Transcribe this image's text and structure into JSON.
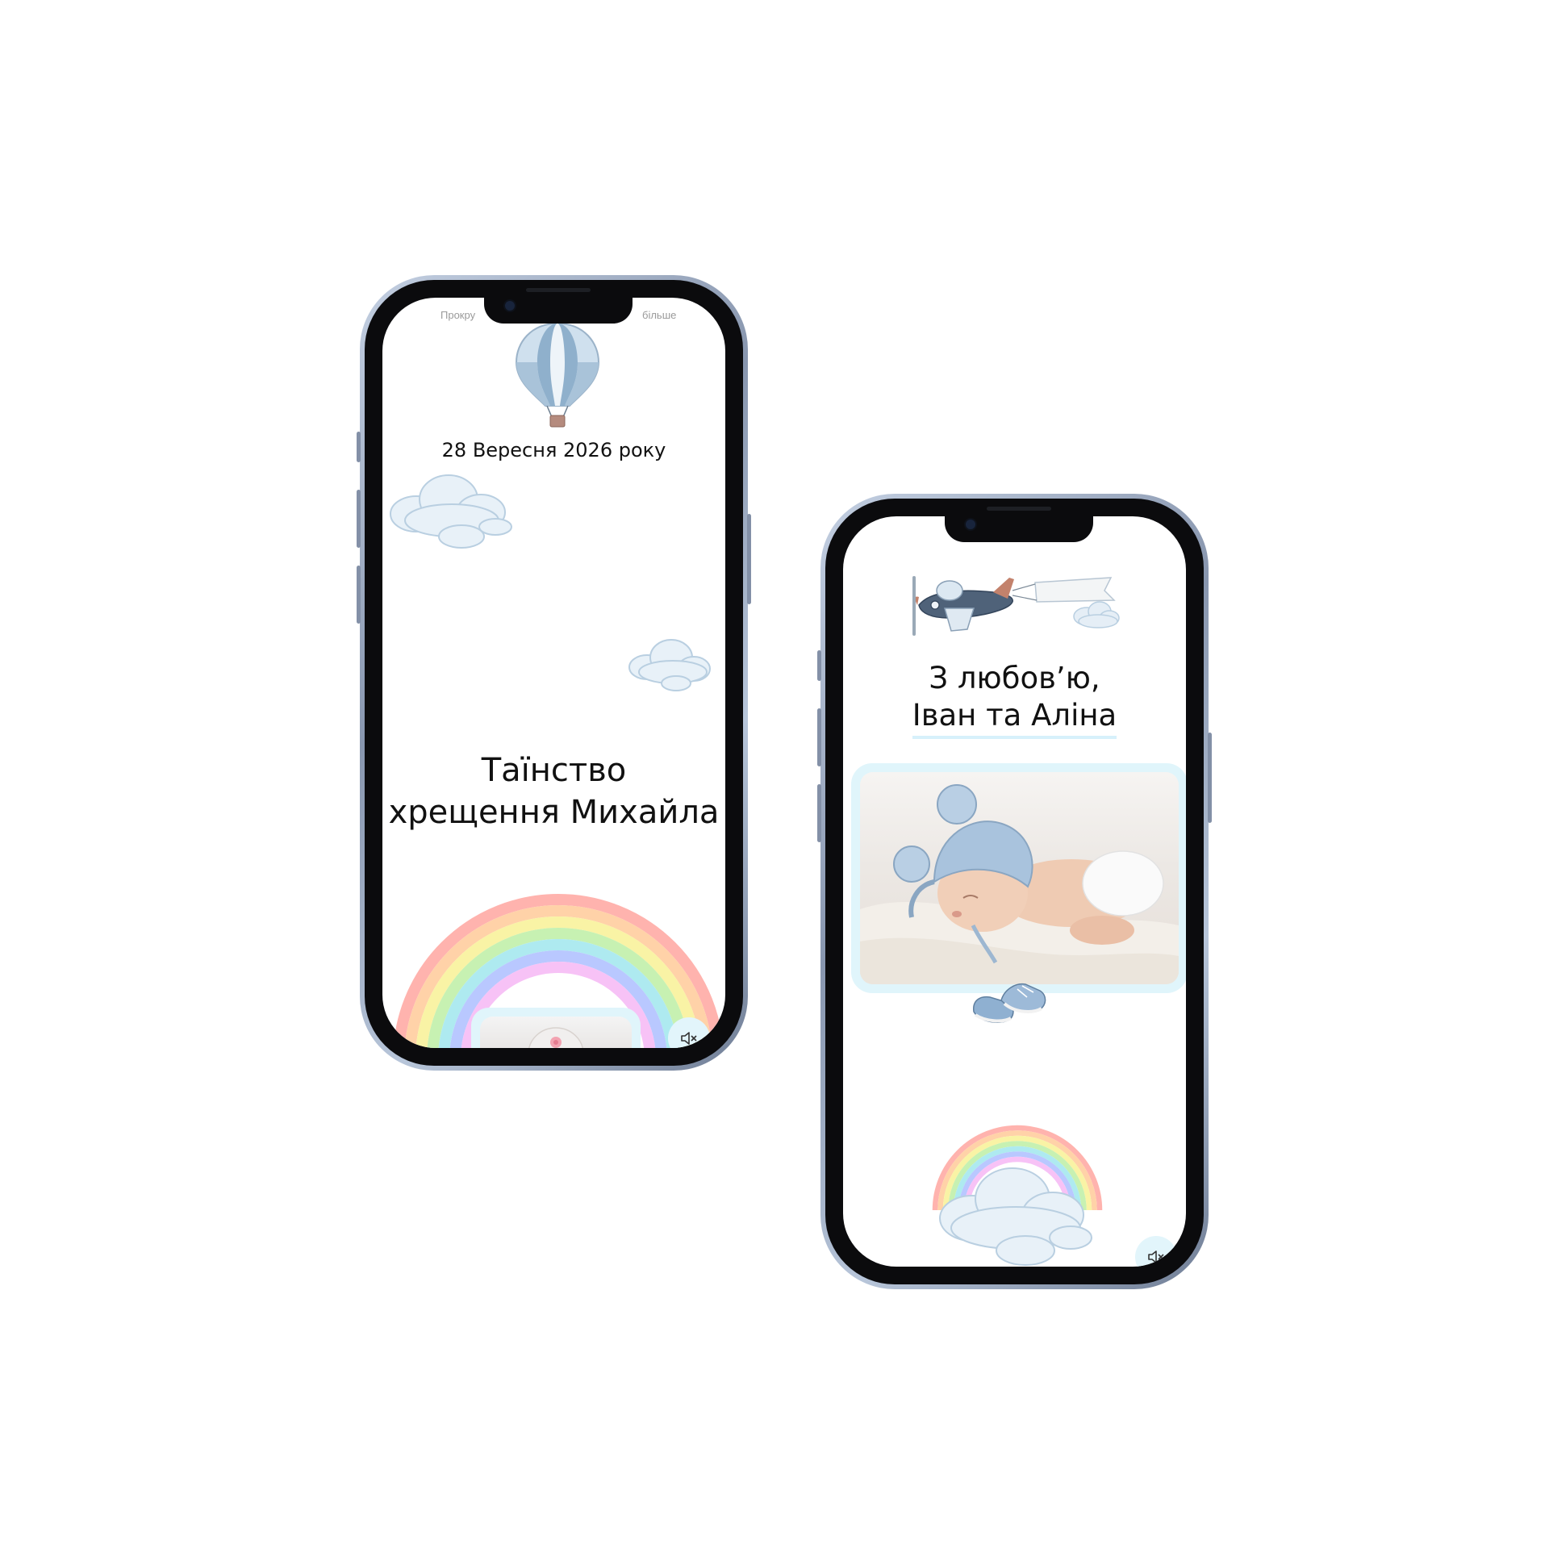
{
  "phone_left": {
    "scroll_hint_left": "Прокру",
    "scroll_hint_right": "більше",
    "date": "28 Вересня 2026 року",
    "title_line1": "Таїнство",
    "title_line2": "хрещення Михайла",
    "sound_icon": "speaker-muted-icon"
  },
  "phone_right": {
    "love_line1": "З любов’ю,",
    "love_line2": "Іван та Аліна",
    "sound_icon": "speaker-muted-icon"
  },
  "colors": {
    "accent_light_blue": "#e0f5fb",
    "phone_frame": "#8896ae",
    "text": "#111111",
    "rainbow": [
      "#ffb3ae",
      "#ffd2a8",
      "#f9f3a5",
      "#c7f1b2",
      "#aeeaf0",
      "#b9c8ff",
      "#f7c2f6"
    ]
  }
}
